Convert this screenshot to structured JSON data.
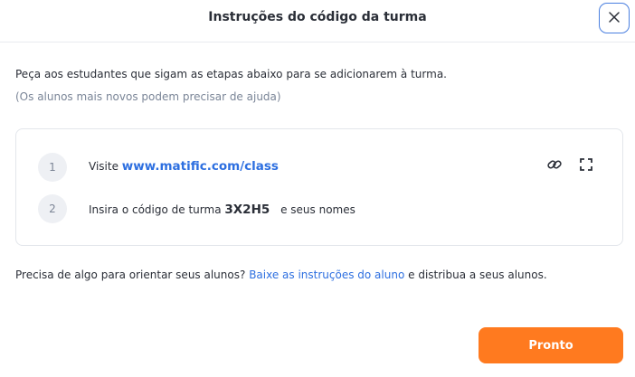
{
  "dialog": {
    "title": "Instruções do código da turma",
    "close_icon": "close-icon"
  },
  "intro": {
    "text": "Peça aos estudantes que sigam as etapas abaixo para se adicionarem à turma.",
    "subtext": "(Os alunos mais novos podem precisar de ajuda)"
  },
  "steps": [
    {
      "number": "1",
      "prefix": "Visite",
      "link": "www.matific.com/class",
      "icons": [
        "link-icon",
        "fullscreen-icon"
      ]
    },
    {
      "number": "2",
      "prefix": "Insira o código de turma",
      "code": "3X2H5",
      "suffix": "e seus nomes"
    }
  ],
  "help": {
    "before": "Precisa de algo para orientar seus alunos?",
    "link": "Baixe as instruções do aluno",
    "after": "e distribua a seus alunos."
  },
  "footer": {
    "done_label": "Pronto"
  },
  "colors": {
    "accent": "#ff7a1f",
    "link": "#2d6fe0",
    "focus_border": "#4a7fe0",
    "muted": "#7a8597"
  }
}
